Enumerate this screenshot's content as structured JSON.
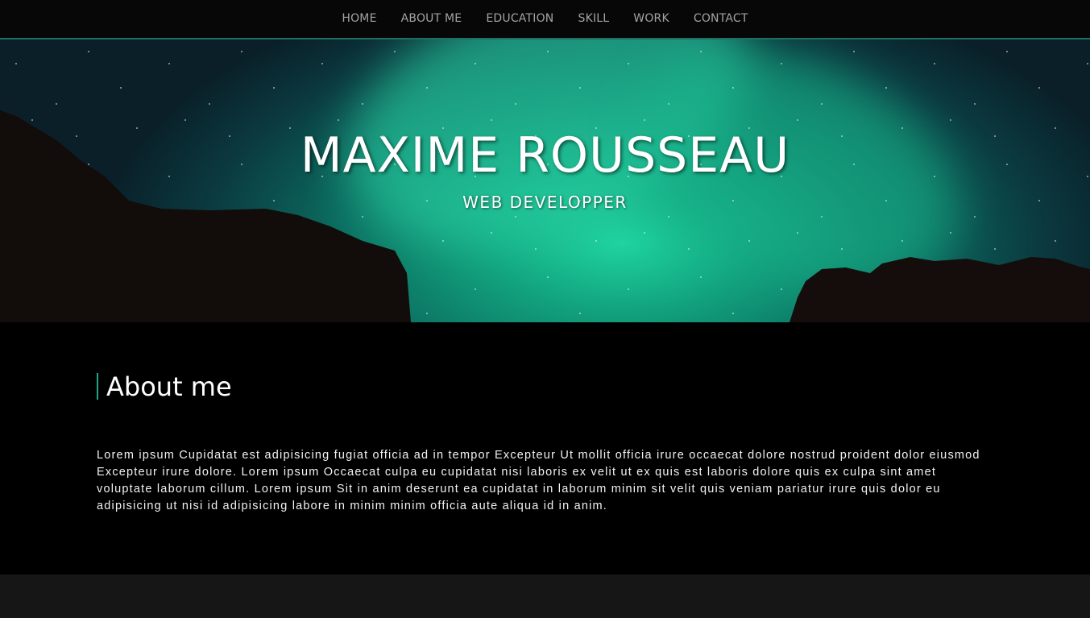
{
  "nav": {
    "items": [
      {
        "label": "HOME"
      },
      {
        "label": "ABOUT ME"
      },
      {
        "label": "EDUCATION"
      },
      {
        "label": "SKILL"
      },
      {
        "label": "WORK"
      },
      {
        "label": "CONTACT"
      }
    ]
  },
  "hero": {
    "name": "MAXIME ROUSSEAU",
    "role": "WEB DEVELOPPER"
  },
  "about": {
    "heading": "About me",
    "body": "Lorem ipsum Cupidatat est adipisicing fugiat officia ad in tempor Excepteur Ut mollit officia irure occaecat dolore nostrud proident dolor eiusmod Excepteur irure dolore. Lorem ipsum Occaecat culpa eu cupidatat nisi laboris ex velit ut ex quis est laboris dolore quis ex culpa sint amet voluptate laborum cillum. Lorem ipsum Sit in anim deserunt ea cupidatat in laborum minim sit velit quis veniam pariatur irure quis dolor eu adipisicing ut nisi id adipisicing labore in minim minim officia aute aliqua id in anim."
  },
  "colors": {
    "accent": "#20a58a",
    "nav_background": "#070707",
    "nav_text": "#a3a3a3",
    "page_background": "#000000",
    "footer_background": "#161616"
  }
}
